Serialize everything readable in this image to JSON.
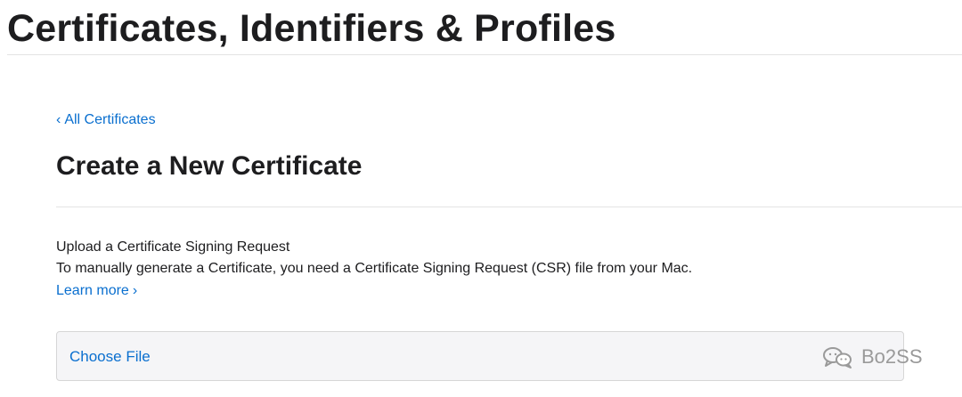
{
  "header": {
    "title": "Certificates, Identifiers & Profiles"
  },
  "navigation": {
    "back_link": "All Certificates",
    "back_chevron": "‹"
  },
  "page": {
    "section_title": "Create a New Certificate"
  },
  "upload": {
    "heading": "Upload a Certificate Signing Request",
    "description": "To manually generate a Certificate, you need a Certificate Signing Request (CSR) file from your Mac.",
    "learn_more_label": "Learn more",
    "learn_more_chevron": "›",
    "choose_file_label": "Choose File"
  },
  "watermark": {
    "icon": "chat-bubbles-icon",
    "text": "Bo2SS"
  },
  "colors": {
    "link": "#0a6fcf",
    "text": "#1d1d1f",
    "divider": "#e3e3e3",
    "input_background": "#f5f5f7",
    "input_border": "#d6d6d6",
    "watermark": "#9a9a9a"
  }
}
